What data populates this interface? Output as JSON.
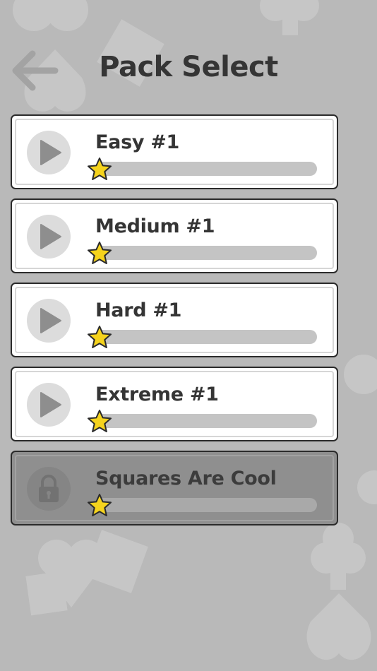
{
  "header": {
    "title": "Pack Select",
    "back_icon": "arrow-left-icon"
  },
  "packs": [
    {
      "name": "Easy #1",
      "locked": false,
      "progress": 0,
      "icon": "play-icon"
    },
    {
      "name": "Medium #1",
      "locked": false,
      "progress": 0,
      "icon": "play-icon"
    },
    {
      "name": "Hard #1",
      "locked": false,
      "progress": 0,
      "icon": "play-icon"
    },
    {
      "name": "Extreme #1",
      "locked": false,
      "progress": 0,
      "icon": "play-icon"
    },
    {
      "name": "Squares Are Cool",
      "locked": true,
      "progress": 0,
      "icon": "lock-icon"
    }
  ],
  "colors": {
    "background": "#b9b9b9",
    "card": "#ffffff",
    "card_locked": "#8f8f8f",
    "text": "#353535",
    "star": "#f5d31d"
  }
}
